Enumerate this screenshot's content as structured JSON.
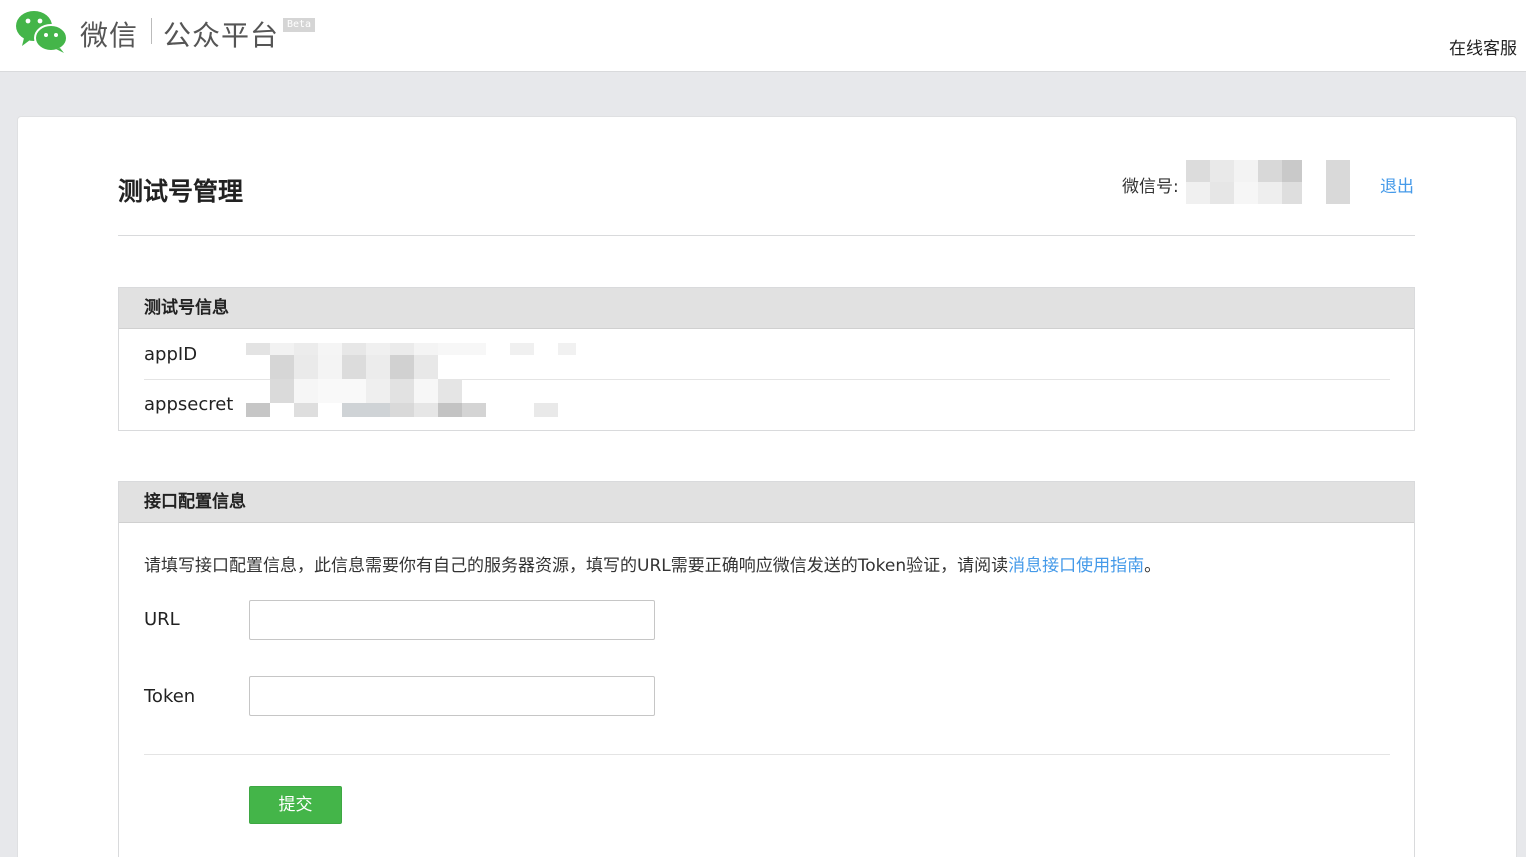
{
  "header": {
    "brand_wechat": "微信",
    "brand_platform": "公众平台",
    "beta": "Beta",
    "support_link": "在线客服"
  },
  "page": {
    "title": "测试号管理",
    "account_label": "微信号:",
    "logout": "退出"
  },
  "test_account_panel": {
    "heading": "测试号信息",
    "rows": [
      {
        "label": "appID"
      },
      {
        "label": "appsecret"
      }
    ]
  },
  "config_panel": {
    "heading": "接口配置信息",
    "description_prefix": "请填写接口配置信息，此信息需要你有自己的服务器资源，填写的URL需要正确响应微信发送的Token验证，请阅读",
    "guide_link": "消息接口使用指南",
    "description_suffix": "。",
    "url_label": "URL",
    "url_value": "",
    "token_label": "Token",
    "token_value": "",
    "submit": "提交"
  },
  "colors": {
    "accent_link": "#459ae9",
    "submit_green": "#44b549",
    "wechat_green": "#44b549"
  },
  "icons": {
    "logo": "wechat-logo-icon"
  }
}
